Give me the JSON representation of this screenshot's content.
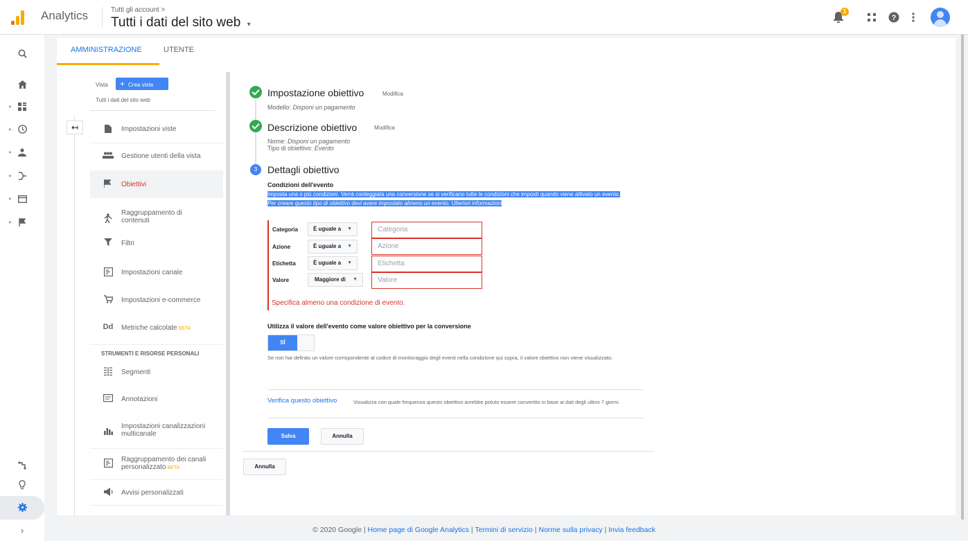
{
  "header": {
    "app_name": "Analytics",
    "account_breadcrumb": "Tutti gli account >",
    "property_title": "Tutti i dati del sito web",
    "notification_count": "1",
    "accent_color": "#f9ab00"
  },
  "tabs": [
    {
      "label": "AMMINISTRAZIONE",
      "active": true
    },
    {
      "label": "UTENTE",
      "active": false
    }
  ],
  "view": {
    "label": "Vista",
    "create_button": "Crea vista",
    "name": "Tutti i dati del sito web"
  },
  "nav": {
    "items": [
      {
        "label": "Impostazioni viste",
        "icon": "document-icon"
      },
      {
        "label": "Gestione utenti della vista",
        "icon": "users-icon"
      },
      {
        "label": "Obiettivi",
        "icon": "flag-icon",
        "selected": true
      },
      {
        "label": "Raggruppamento di contenuti",
        "icon": "walk-icon"
      },
      {
        "label": "Filtri",
        "icon": "filter-icon"
      },
      {
        "label": "Impostazioni canale",
        "icon": "channel-icon"
      },
      {
        "label": "Impostazioni e-commerce",
        "icon": "cart-icon"
      },
      {
        "label": "Metriche calcolate",
        "icon": "dd-icon",
        "badge": "BETA"
      },
      {
        "label": "Segmenti",
        "icon": "segments-icon"
      },
      {
        "label": "Annotazioni",
        "icon": "annotation-icon"
      },
      {
        "label": "Impostazioni canalizzazioni multicanale",
        "icon": "bar-chart-icon"
      },
      {
        "label": "Raggruppamento dei canali personalizzato",
        "icon": "grouping-icon",
        "badge": "BETA"
      },
      {
        "label": "Avvisi personalizzati",
        "icon": "megaphone-icon"
      }
    ],
    "section_title": "STRUMENTI E RISORSE PERSONALI"
  },
  "steps": {
    "setup": {
      "title": "Impostazione obiettivo",
      "edit": "Modifica",
      "meta_label": "Modello:",
      "meta_value": "Disponi un pagamento"
    },
    "description": {
      "title": "Descrizione obiettivo",
      "edit": "Modifica",
      "name_label": "Nome:",
      "name_value": "Disponi un pagamento",
      "type_label": "Tipo di obiettivo:",
      "type_value": "Evento"
    },
    "details": {
      "number": "3",
      "title": "Dettagli obiettivo"
    }
  },
  "conditions": {
    "title": "Condizioni dell'evento",
    "desc_1": "Imposta una o più condizioni. Verrà conteggiata una conversione se si verificano tutte le condizioni che imposti quando viene attivato un evento.",
    "desc_2": "Per creare questo tipo di obiettivo devi avere impostato almeno un evento.",
    "desc_3": "Ulteriori informazioni",
    "rows": [
      {
        "label": "Categoria",
        "operator": "È uguale a",
        "placeholder": "Categoria"
      },
      {
        "label": "Azione",
        "operator": "È uguale a",
        "placeholder": "Azione"
      },
      {
        "label": "Etichetta",
        "operator": "È uguale a",
        "placeholder": "Etichetta"
      },
      {
        "label": "Valore",
        "operator": "Maggiore di",
        "placeholder": "Valore"
      }
    ],
    "error": "Specifica almeno una condizione di evento."
  },
  "event_value": {
    "title": "Utilizza il valore dell'evento come valore obiettivo per la conversione",
    "toggle_label": "SÌ",
    "note": "Se non hai definito un valore corrispondente al codice di monitoraggio degli eventi nella condizione qui sopra, il valore obiettivo non viene visualizzato."
  },
  "verify": {
    "link": "Verifica questo obiettivo",
    "text": "Visualizza con quale frequenza questo obiettivo avrebbe potuto essere convertito in base ai dati degli ultimi 7 giorni."
  },
  "buttons": {
    "save": "Salva",
    "cancel": "Annulla",
    "cancel_outer": "Annulla"
  },
  "footer": {
    "copyright": "© 2020 Google",
    "links": [
      "Home page di Google Analytics",
      "Termini di servizio",
      "Norme sulla privacy",
      "Invia feedback"
    ]
  }
}
